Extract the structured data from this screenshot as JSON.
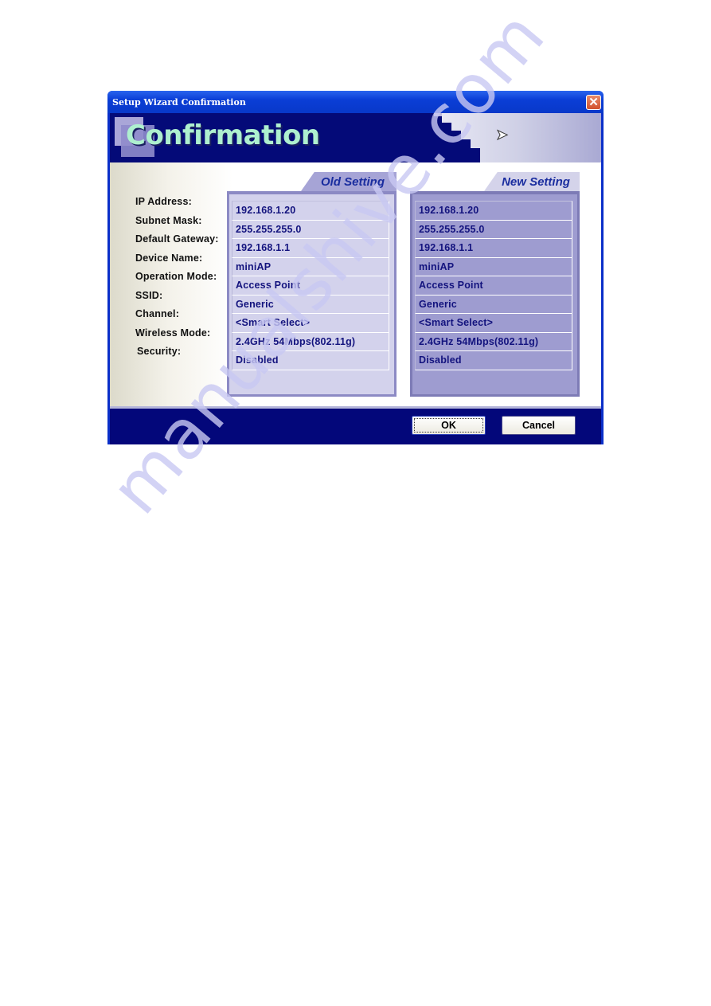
{
  "window": {
    "title": "Setup Wizard Confirmation",
    "close_icon": "close-x-icon"
  },
  "banner": {
    "title": "Confirmation",
    "cursor_icon": "mouse-pointer-icon"
  },
  "labels": [
    "IP Address:",
    "Subnet Mask:",
    "Default Gateway:",
    "Device Name:",
    "Operation Mode:",
    "SSID:",
    "Channel:",
    "Wireless Mode:",
    "Security:"
  ],
  "old_setting": {
    "title": "Old Setting",
    "values": [
      "192.168.1.20",
      "255.255.255.0",
      "192.168.1.1",
      "miniAP",
      "Access Point",
      "Generic",
      "<Smart Select>",
      "2.4GHz 54Mbps(802.11g)",
      "Disabled"
    ]
  },
  "new_setting": {
    "title": "New Setting",
    "values": [
      "192.168.1.20",
      "255.255.255.0",
      "192.168.1.1",
      "miniAP",
      "Access Point",
      "Generic",
      "<Smart Select>",
      "2.4GHz 54Mbps(802.11g)",
      "Disabled"
    ]
  },
  "buttons": {
    "ok": "OK",
    "cancel": "Cancel"
  },
  "watermark": "manualshive.com",
  "colors": {
    "title_bar": "#0b3ed6",
    "banner_bg": "#040a78",
    "banner_title": "#aef0cf",
    "value_text": "#13137e",
    "tab_text": "#1a2d9f",
    "close_button": "#d2522e"
  }
}
